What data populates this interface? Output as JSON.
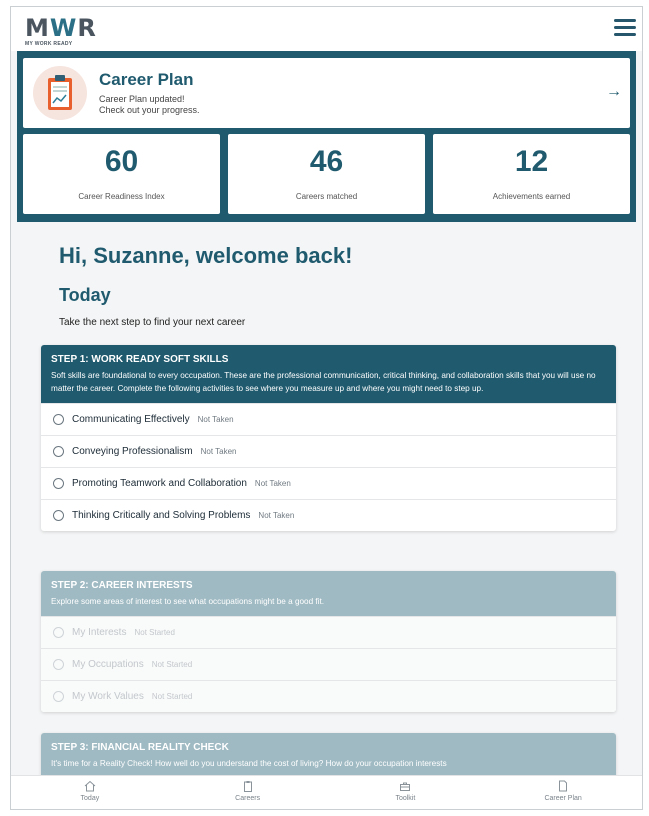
{
  "header": {
    "logo_text": "MWR",
    "logo_subtitle": "MY WORK READY",
    "menu_icon": "hamburger-menu-icon"
  },
  "career_plan_card": {
    "title": "Career Plan",
    "line1": "Career Plan updated!",
    "line2": "Check out your progress.",
    "arrow": "→",
    "icon": "clipboard-chart-icon"
  },
  "stats": [
    {
      "value": "60",
      "label": "Career Readiness Index"
    },
    {
      "value": "46",
      "label": "Careers matched"
    },
    {
      "value": "12",
      "label": "Achievements earned"
    }
  ],
  "greeting": "Hi, Suzanne, welcome back!",
  "today": {
    "heading": "Today",
    "subtitle": "Take the next step to find your next career"
  },
  "steps": [
    {
      "title": "STEP 1: WORK READY SOFT SKILLS",
      "description": "Soft skills are foundational to every occupation. These are the professional communication, critical thinking, and collaboration skills that you will use no matter the career. Complete the following activities to see where you measure up and where you might need to step up.",
      "items": [
        {
          "label": "Communicating Effectively",
          "status": "Not Taken"
        },
        {
          "label": "Conveying Professionalism",
          "status": "Not Taken"
        },
        {
          "label": "Promoting Teamwork and Collaboration",
          "status": "Not Taken"
        },
        {
          "label": "Thinking Critically and Solving Problems",
          "status": "Not Taken"
        }
      ]
    },
    {
      "title": "STEP 2: CAREER INTERESTS",
      "description": "Explore some areas of interest to see what occupations might be a good fit.",
      "items": [
        {
          "label": "My Interests",
          "status": "Not Started"
        },
        {
          "label": "My Occupations",
          "status": "Not Started"
        },
        {
          "label": "My Work Values",
          "status": "Not Started"
        }
      ]
    },
    {
      "title": "STEP 3: FINANCIAL REALITY CHECK",
      "description": "It's time for a Reality Check! How well do you understand the cost of living? How do your occupation interests",
      "items": []
    }
  ],
  "bottom_nav": [
    {
      "label": "Today",
      "icon": "home-icon"
    },
    {
      "label": "Careers",
      "icon": "clipboard-icon"
    },
    {
      "label": "Toolkit",
      "icon": "toolbox-icon"
    },
    {
      "label": "Career Plan",
      "icon": "document-icon"
    }
  ],
  "colors": {
    "primary_teal": "#1f5a6e",
    "locked_teal": "#9fbac3",
    "plan_icon_bg": "#f6e4de"
  }
}
